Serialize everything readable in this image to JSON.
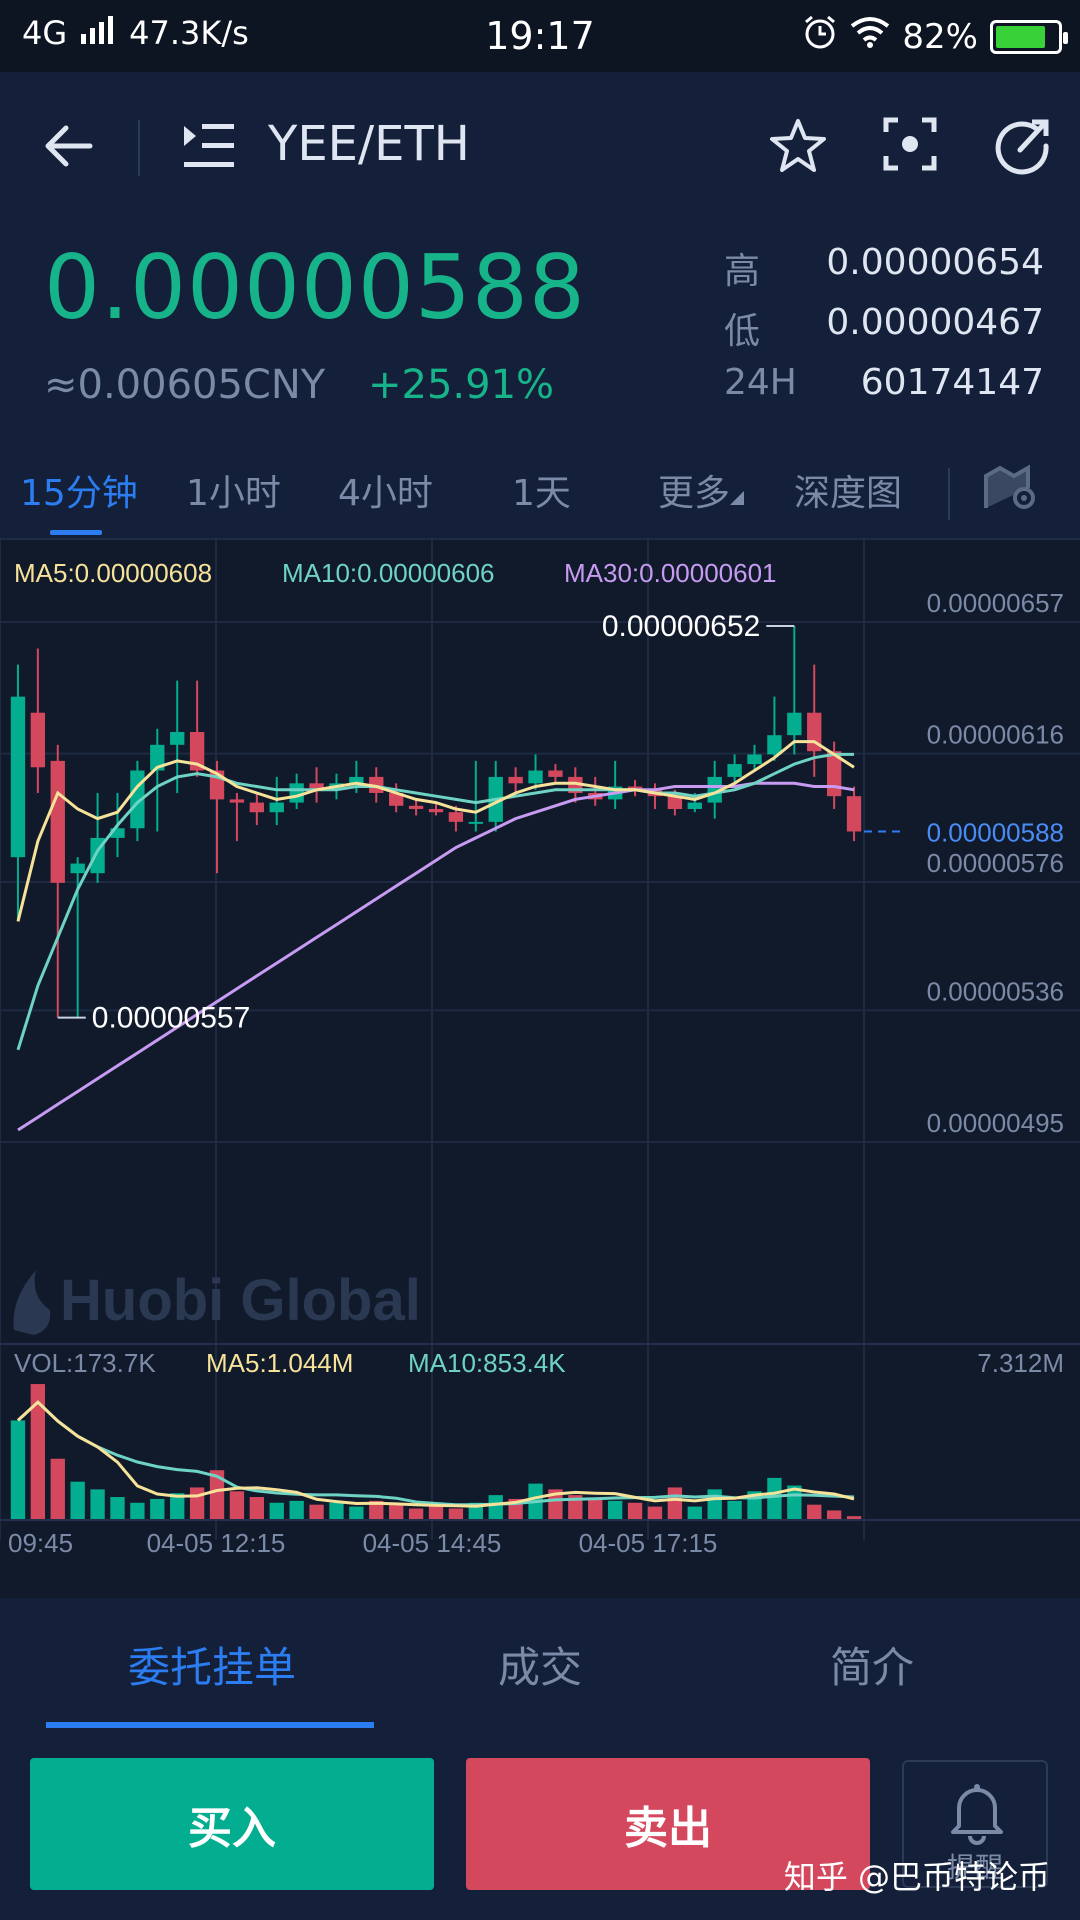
{
  "status_bar": {
    "network": "4G",
    "speed": "47.3K/s",
    "time": "19:17",
    "battery": "82%",
    "battery_level": 0.82
  },
  "header": {
    "pair": "YEE/ETH"
  },
  "price": {
    "last": "0.00000588",
    "cny": "≈0.00605CNY",
    "change": "+25.91%",
    "high_label": "高",
    "high": "0.00000654",
    "low_label": "低",
    "low": "0.00000467",
    "vol_label": "24H",
    "vol": "60174147"
  },
  "timeframes": {
    "items": [
      "15分钟",
      "1小时",
      "4小时",
      "1天",
      "更多",
      "深度图"
    ],
    "active": "15分钟"
  },
  "chart_data": {
    "type": "candlestick",
    "ma_labels": {
      "ma5": "MA5:0.00000608",
      "ma10": "MA10:0.00000606",
      "ma30": "MA30:0.00000601"
    },
    "y_ticks": [
      "0.00000657",
      "0.00000616",
      "0.00000576",
      "0.00000536",
      "0.00000495"
    ],
    "y_tick_values": [
      6.57,
      6.16,
      5.76,
      5.36,
      4.95
    ],
    "current_price_label": "0.00000588",
    "current_price": 5.88,
    "max_label": "0.00000652",
    "min_label": "0.00000557",
    "watermark": "Huobi Global",
    "candles": [
      [
        5.8,
        6.3,
        6.4,
        5.6
      ],
      [
        6.25,
        6.08,
        6.45,
        6.0
      ],
      [
        6.1,
        5.72,
        6.15,
        5.3
      ],
      [
        5.75,
        5.78,
        5.8,
        5.3
      ],
      [
        5.75,
        5.86,
        6.0,
        5.72
      ],
      [
        5.86,
        5.89,
        6.0,
        5.8
      ],
      [
        5.89,
        6.07,
        6.1,
        5.85
      ],
      [
        6.07,
        6.15,
        6.2,
        5.88
      ],
      [
        6.15,
        6.19,
        6.35,
        6.0
      ],
      [
        6.19,
        6.07,
        6.35,
        6.05
      ],
      [
        6.07,
        5.98,
        6.1,
        5.75
      ],
      [
        5.98,
        5.97,
        6.0,
        5.85
      ],
      [
        5.97,
        5.94,
        6.0,
        5.9
      ],
      [
        5.94,
        5.97,
        6.05,
        5.9
      ],
      [
        5.97,
        6.03,
        6.06,
        5.95
      ],
      [
        6.03,
        6.01,
        6.08,
        5.97
      ],
      [
        6.01,
        6.03,
        6.06,
        5.98
      ],
      [
        6.03,
        6.05,
        6.1,
        6.0
      ],
      [
        6.05,
        6.0,
        6.08,
        5.97
      ],
      [
        6.0,
        5.96,
        6.03,
        5.94
      ],
      [
        5.96,
        5.95,
        5.98,
        5.93
      ],
      [
        5.95,
        5.94,
        5.97,
        5.93
      ],
      [
        5.94,
        5.91,
        5.96,
        5.88
      ],
      [
        5.91,
        5.91,
        6.1,
        5.88
      ],
      [
        5.91,
        6.05,
        6.1,
        5.88
      ],
      [
        6.05,
        6.03,
        6.08,
        6.0
      ],
      [
        6.03,
        6.07,
        6.12,
        6.01
      ],
      [
        6.07,
        6.05,
        6.09,
        6.03
      ],
      [
        6.05,
        6.0,
        6.08,
        5.97
      ],
      [
        6.0,
        5.98,
        6.05,
        5.96
      ],
      [
        5.98,
        6.02,
        6.1,
        5.95
      ],
      [
        6.02,
        6.01,
        6.04,
        5.99
      ],
      [
        6.01,
        5.99,
        6.03,
        5.95
      ],
      [
        5.99,
        5.95,
        6.01,
        5.93
      ],
      [
        5.95,
        5.97,
        6.0,
        5.94
      ],
      [
        5.97,
        6.05,
        6.1,
        5.92
      ],
      [
        6.05,
        6.09,
        6.12,
        6.02
      ],
      [
        6.09,
        6.12,
        6.15,
        6.07
      ],
      [
        6.12,
        6.18,
        6.3,
        6.1
      ],
      [
        6.18,
        6.25,
        6.52,
        6.12
      ],
      [
        6.25,
        6.13,
        6.4,
        6.05
      ],
      [
        6.13,
        5.99,
        6.16,
        5.95
      ],
      [
        5.99,
        5.88,
        6.02,
        5.85
      ]
    ],
    "ma5": [
      5.6,
      5.85,
      6.0,
      5.95,
      5.92,
      5.94,
      6.02,
      6.08,
      6.1,
      6.09,
      6.06,
      6.02,
      6.0,
      5.98,
      5.99,
      6.01,
      6.02,
      6.03,
      6.02,
      6.0,
      5.98,
      5.97,
      5.95,
      5.94,
      5.97,
      6.0,
      6.02,
      6.03,
      6.03,
      6.02,
      6.01,
      6.01,
      6.0,
      5.99,
      5.98,
      6.0,
      6.03,
      6.07,
      6.11,
      6.16,
      6.16,
      6.12,
      6.08
    ],
    "ma10": [
      5.2,
      5.4,
      5.55,
      5.7,
      5.82,
      5.9,
      5.97,
      6.02,
      6.05,
      6.06,
      6.05,
      6.03,
      6.02,
      6.01,
      6.01,
      6.01,
      6.01,
      6.02,
      6.02,
      6.01,
      6.0,
      5.99,
      5.98,
      5.97,
      5.98,
      5.99,
      6.0,
      6.01,
      6.01,
      6.01,
      6.01,
      6.01,
      6.0,
      6.0,
      5.99,
      6.0,
      6.01,
      6.03,
      6.06,
      6.09,
      6.11,
      6.12,
      6.12
    ],
    "ma30": [
      4.95,
      4.99,
      5.03,
      5.07,
      5.11,
      5.15,
      5.19,
      5.23,
      5.27,
      5.31,
      5.35,
      5.39,
      5.43,
      5.47,
      5.51,
      5.55,
      5.59,
      5.63,
      5.67,
      5.71,
      5.75,
      5.79,
      5.83,
      5.86,
      5.89,
      5.92,
      5.94,
      5.96,
      5.98,
      5.99,
      6.0,
      6.01,
      6.01,
      6.02,
      6.02,
      6.02,
      6.02,
      6.03,
      6.03,
      6.03,
      6.02,
      6.02,
      6.01
    ],
    "volume": {
      "label": "VOL:173.7K",
      "ma5_label": "MA5:1.044M",
      "ma10_label": "MA10:853.4K",
      "max_label": "7.312M",
      "max": 7.312,
      "values": [
        5.2,
        7.1,
        3.2,
        2.0,
        1.6,
        1.2,
        0.9,
        1.1,
        1.4,
        1.7,
        2.6,
        1.5,
        1.2,
        0.9,
        1.0,
        0.8,
        0.9,
        0.7,
        1.0,
        0.8,
        0.6,
        0.7,
        0.6,
        0.9,
        1.3,
        1.1,
        1.9,
        1.6,
        1.3,
        1.1,
        1.0,
        0.9,
        0.7,
        1.7,
        0.7,
        1.6,
        1.0,
        1.5,
        2.2,
        1.8,
        0.8,
        0.5,
        0.2
      ]
    },
    "x_labels": [
      "09:45",
      "04-05 12:15",
      "04-05 14:45",
      "04-05 17:15"
    ]
  },
  "bottom_tabs": {
    "items": [
      "委托挂单",
      "成交",
      "简介"
    ]
  },
  "actions": {
    "buy": "买入",
    "sell": "卖出",
    "remind": "提醒"
  },
  "watermark_text": "知乎 @巴币特论币",
  "colors": {
    "up": "#03ad8f",
    "down": "#d4485e",
    "ma5": "#f7e29a",
    "ma10": "#6fd3c4",
    "ma30": "#c89bf3",
    "accent": "#2b7df1"
  }
}
